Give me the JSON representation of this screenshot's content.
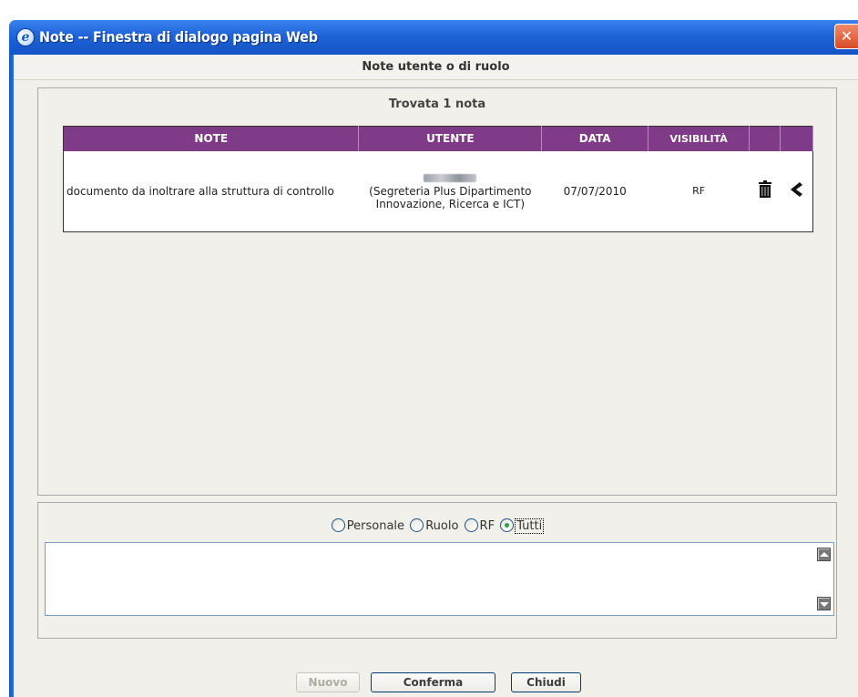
{
  "window": {
    "title": "Note -- Finestra di dialogo pagina Web",
    "close_glyph": "✕",
    "app_icon": "ie-icon"
  },
  "dialog": {
    "header": "Note utente o di ruolo"
  },
  "notes": {
    "found_text": "Trovata 1 nota",
    "columns": [
      "NOTE",
      "UTENTE",
      "DATA",
      "VISIBILITÀ",
      "",
      ""
    ],
    "rows": [
      {
        "note": "documento da inoltrare alla struttura di controllo",
        "user_detail": "(Segreteria Plus Dipartimento Innovazione, Ricerca e ICT)",
        "date": "07/07/2010",
        "visibility": "RF",
        "delete_icon": "trash-icon",
        "select_icon": "back-arrow-icon"
      }
    ]
  },
  "filter": {
    "options": [
      {
        "label": "Personale",
        "checked": false
      },
      {
        "label": "Ruolo",
        "checked": false
      },
      {
        "label": "RF",
        "checked": false
      },
      {
        "label": "Tutti",
        "checked": true
      }
    ],
    "text_value": ""
  },
  "buttons": {
    "new": "Nuovo",
    "confirm": "Conferma",
    "close": "Chiudi"
  },
  "colors": {
    "table_header": "#7f3b87",
    "titlebar": "#1f63d8"
  }
}
